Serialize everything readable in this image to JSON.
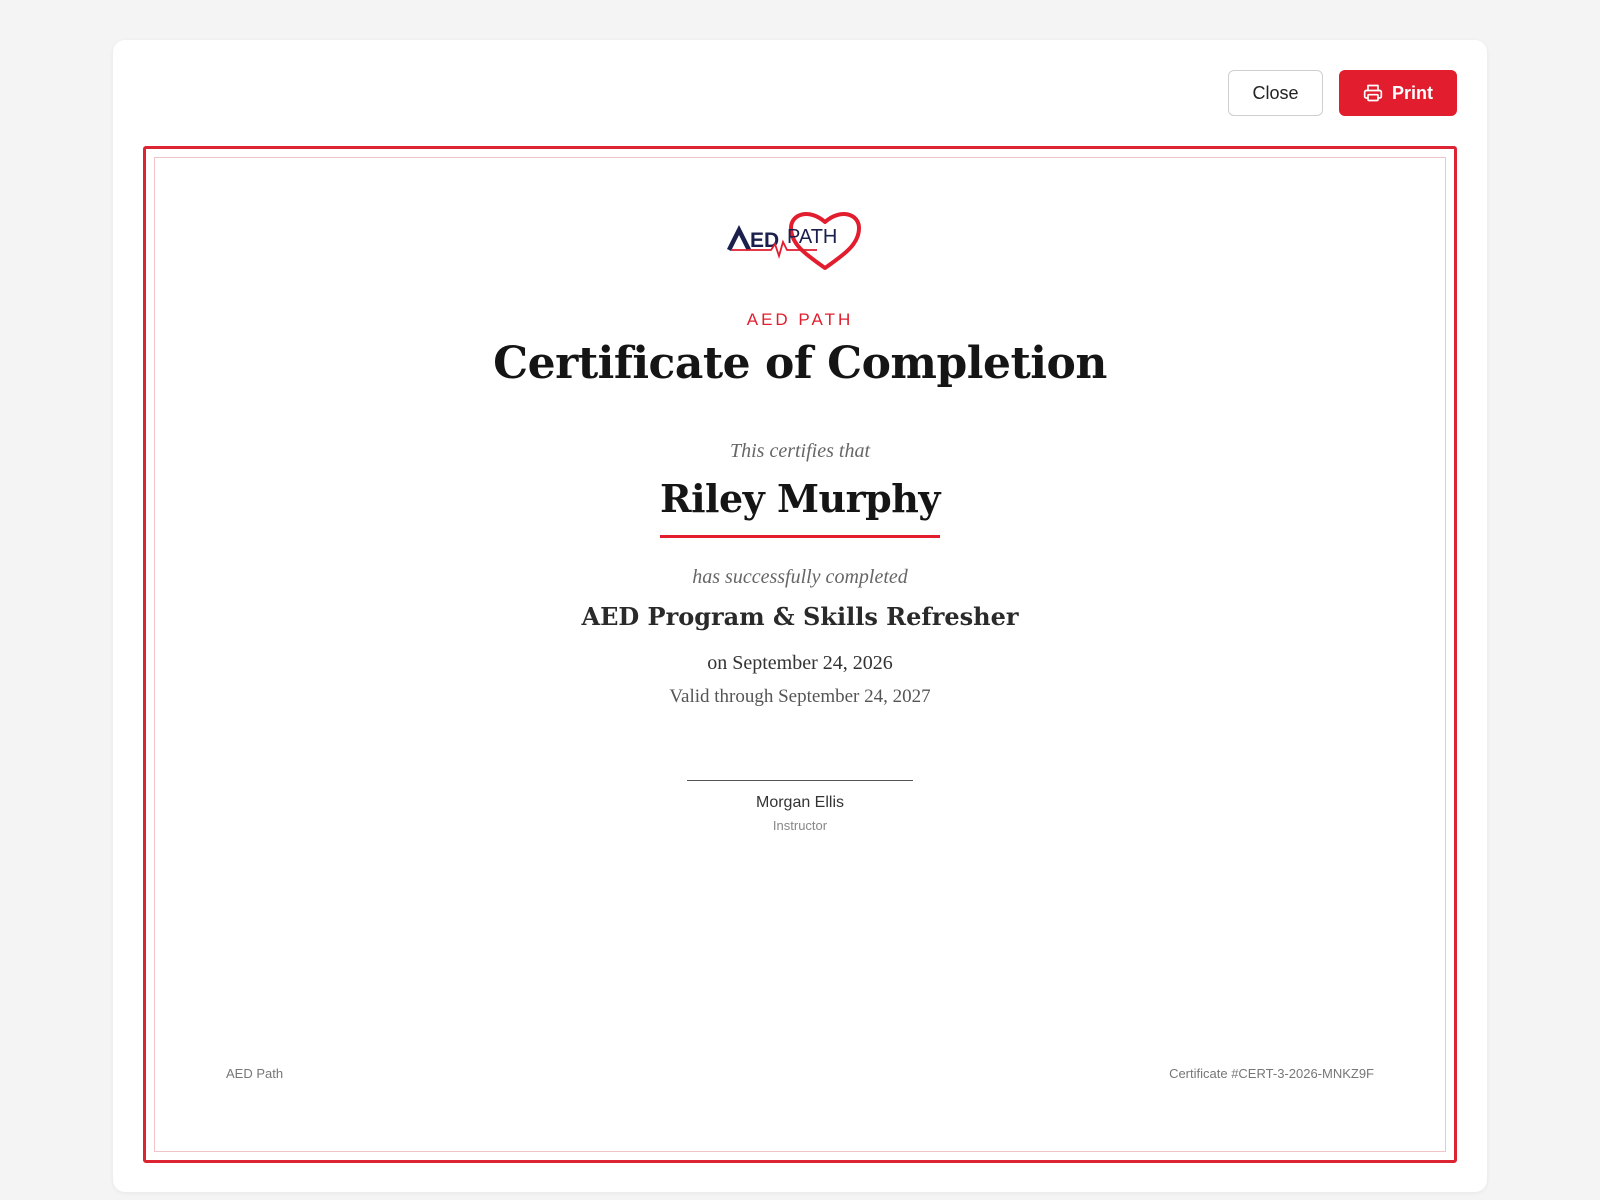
{
  "toolbar": {
    "close_label": "Close",
    "print_label": "Print"
  },
  "certificate": {
    "logo": {
      "text_a": "AED",
      "text_b": "PATH",
      "icon": "heart-ecg-logo-icon"
    },
    "brand_kicker": "AED PATH",
    "title": "Certificate of Completion",
    "certifies_text": "This certifies that",
    "recipient_name": "Riley Murphy",
    "completed_text": "has successfully completed",
    "course_name": "AED Program & Skills Refresher",
    "completion_date": "on September 24, 2026",
    "valid_through": "Valid through September 24, 2027",
    "signature": {
      "name": "Morgan Ellis",
      "role": "Instructor"
    },
    "footer": {
      "organization": "AED Path",
      "certificate_number": "Certificate #CERT-3-2026-MNKZ9F"
    }
  },
  "colors": {
    "accent": "#e11d2e",
    "border": "#dc2433",
    "navy": "#1b1f4b"
  }
}
